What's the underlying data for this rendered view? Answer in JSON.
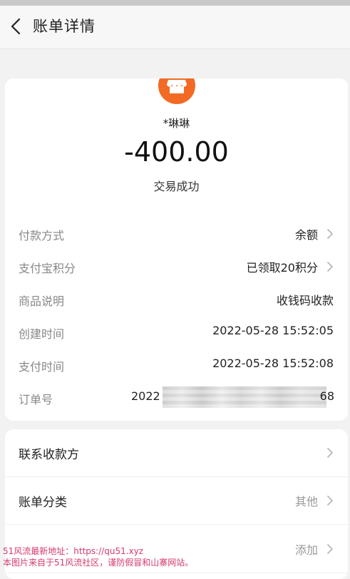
{
  "header": {
    "title": "账单详情"
  },
  "transaction": {
    "payee": "*琳琳",
    "amount": "-400.00",
    "status": "交易成功"
  },
  "details": [
    {
      "label": "付款方式",
      "value": "余额"
    },
    {
      "label": "支付宝积分",
      "value": "已领取20积分"
    },
    {
      "label": "商品说明",
      "value": "收钱码收款"
    },
    {
      "label": "创建时间",
      "value": "2022-05-28 15:52:05"
    },
    {
      "label": "支付时间",
      "value": "2022-05-28 15:52:08"
    }
  ],
  "order": {
    "label": "订单号",
    "value_start": "2022",
    "value_end": "68"
  },
  "actions": [
    {
      "label": "联系收款方",
      "value": ""
    },
    {
      "label": "账单分类",
      "value": "其他"
    },
    {
      "label": "",
      "value": "添加"
    }
  ],
  "watermark": {
    "line1": "51风流最新地址：https://qu51.xyz",
    "line2": "本图片来自于51风流社区，谨防假冒和山寨网站。"
  },
  "colors": {
    "accent": "#f26a24",
    "watermark": "#d63a6b"
  },
  "icons": [
    "back-arrow-icon",
    "shop-icon",
    "chevron-right-icon"
  ]
}
